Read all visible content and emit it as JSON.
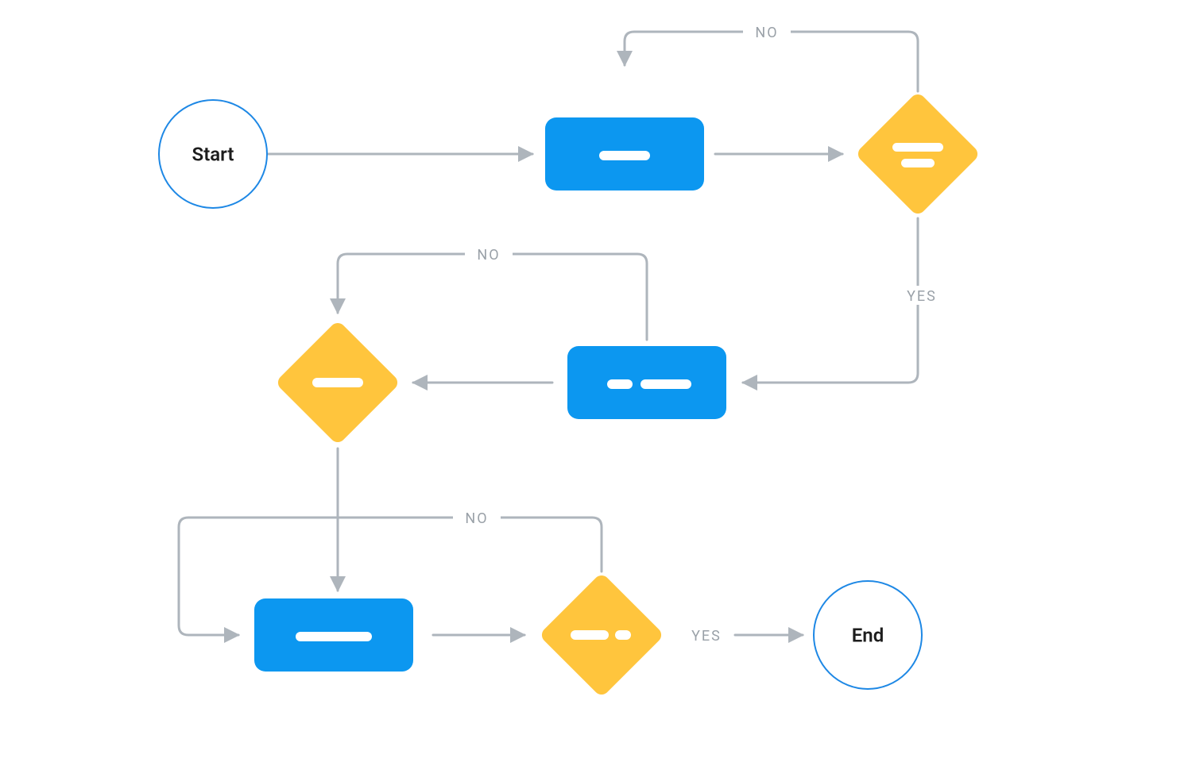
{
  "diagram": {
    "type": "flowchart",
    "colors": {
      "process": "#0C97F0",
      "decision": "#FFC53D",
      "terminal_stroke": "#1E88E5",
      "connector": "#AEB5BC",
      "label": "#9AA1A8",
      "text": "#1d1d1d"
    },
    "nodes": {
      "start": {
        "type": "terminal",
        "label": "Start"
      },
      "end": {
        "type": "terminal",
        "label": "End"
      },
      "process1": {
        "type": "process"
      },
      "process2": {
        "type": "process"
      },
      "process3": {
        "type": "process"
      },
      "decision1": {
        "type": "decision"
      },
      "decision2": {
        "type": "decision"
      },
      "decision3": {
        "type": "decision"
      }
    },
    "edges": [
      {
        "from": "start",
        "to": "process1",
        "label": ""
      },
      {
        "from": "process1",
        "to": "decision1",
        "label": ""
      },
      {
        "from": "decision1",
        "to": "process1",
        "label": "NO"
      },
      {
        "from": "decision1",
        "to": "process2",
        "label": "YES"
      },
      {
        "from": "process2",
        "to": "decision2",
        "label": ""
      },
      {
        "from": "process2",
        "to": "decision2_no_loopback",
        "label": "NO"
      },
      {
        "from": "decision2",
        "to": "process3",
        "label": ""
      },
      {
        "from": "process3",
        "to": "decision3",
        "label": ""
      },
      {
        "from": "decision3",
        "to": "process3",
        "label": "NO"
      },
      {
        "from": "decision3",
        "to": "end",
        "label": "YES"
      }
    ],
    "labels": {
      "no1": "NO",
      "yes1": "YES",
      "no2": "NO",
      "no3": "NO",
      "yes3": "YES"
    }
  }
}
